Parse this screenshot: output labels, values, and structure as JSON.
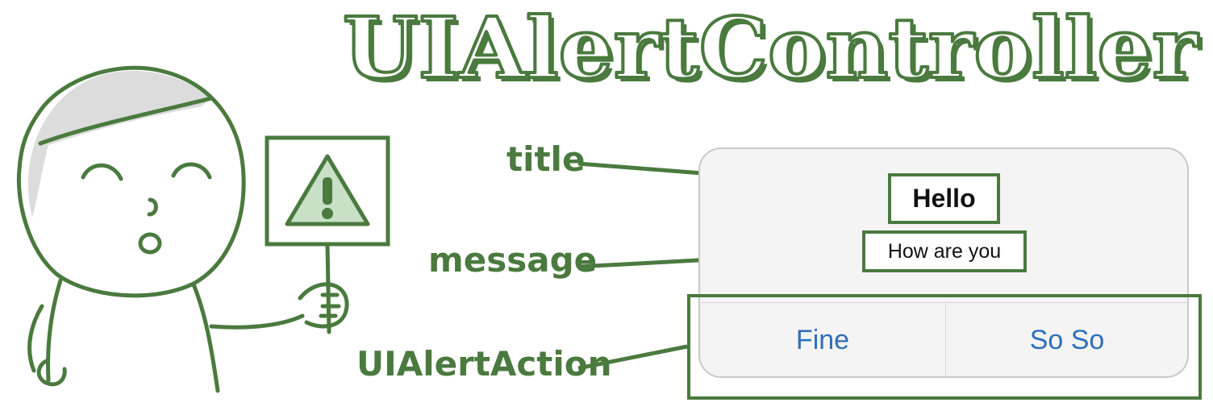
{
  "banner": {
    "title": "UIAlertController"
  },
  "labels": {
    "title": "title",
    "message": "message",
    "action": "UIAlertAction"
  },
  "alert": {
    "title": "Hello",
    "message": "How are you",
    "actions": [
      "Fine",
      "So So"
    ]
  },
  "colors": {
    "accent_green": "#4a7a3e",
    "action_blue": "#2f6fb8",
    "alert_background": "#f4f4f4",
    "warning_fill": "#c8e0c6"
  },
  "icons": [
    "warning-sign-icon",
    "cartoon-character"
  ]
}
